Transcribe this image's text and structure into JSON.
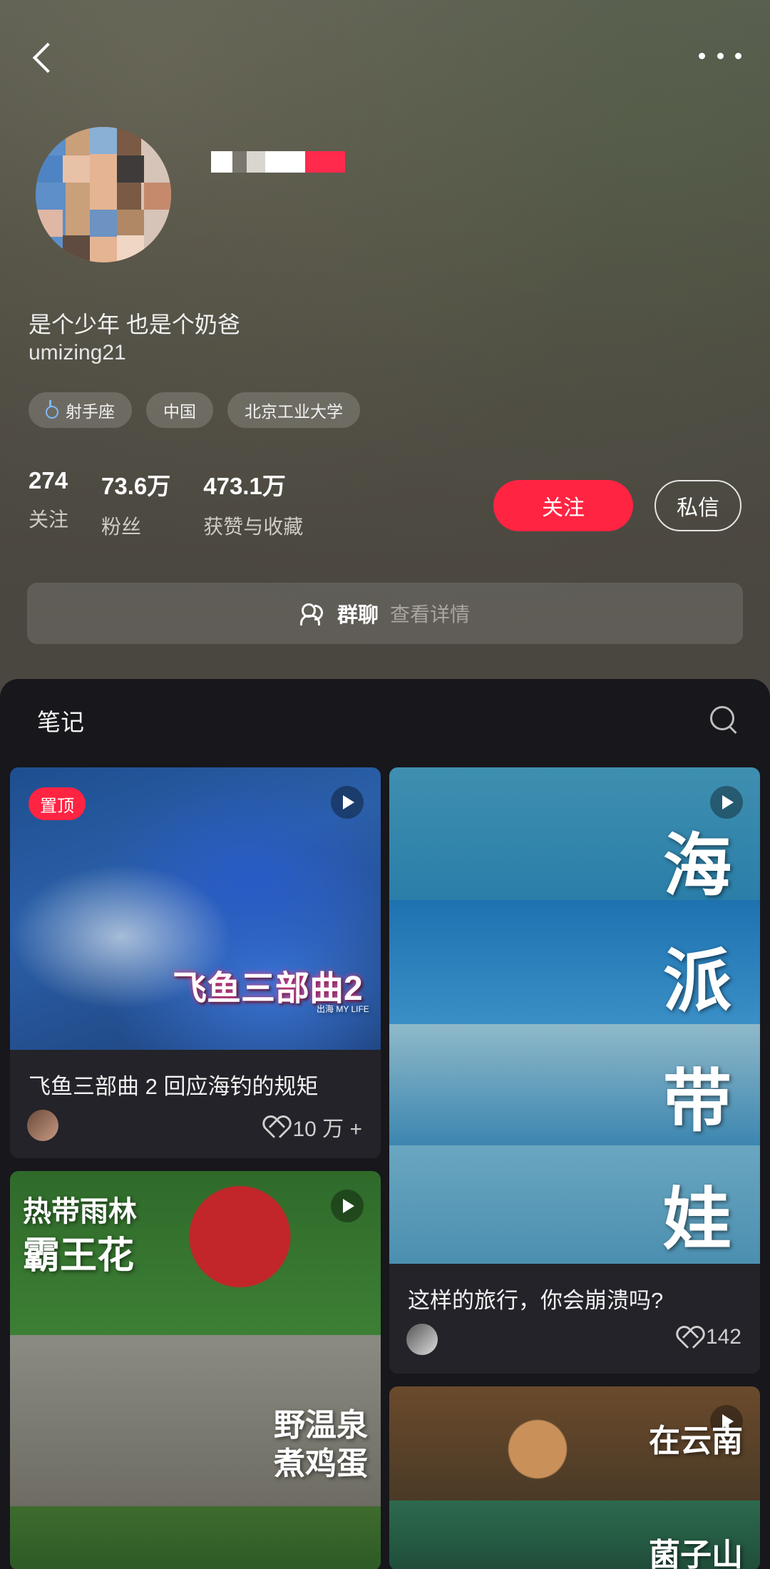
{
  "topbar": {
    "back_icon": "chevron-left-icon",
    "more_icon": "more-dots-icon"
  },
  "profile": {
    "bio": "是个少年 也是个奶爸",
    "user_id": "umizing21",
    "tags": [
      {
        "label": "射手座",
        "icon": "male-icon"
      },
      {
        "label": "中国"
      },
      {
        "label": "北京工业大学"
      }
    ],
    "stats": [
      {
        "value": "274",
        "label": "关注"
      },
      {
        "value": "73.6万",
        "label": "粉丝"
      },
      {
        "value": "473.1万",
        "label": "获赞与收藏"
      }
    ],
    "follow_label": "关注",
    "message_label": "私信"
  },
  "group_chat": {
    "title": "群聊",
    "detail": "查看详情"
  },
  "notes": {
    "tab_label": "笔记",
    "cards": [
      {
        "badge": "置顶",
        "cover_text": "飞鱼三部曲2",
        "cover_subtext": "出海 MY LIFE",
        "title": "飞鱼三部曲 2 回应海钓的规矩",
        "likes": "10 万 +"
      },
      {
        "cover_texts": [
          "海",
          "派",
          "带",
          "娃"
        ],
        "title": "这样的旅行，你会崩溃吗?",
        "likes": "142"
      },
      {
        "cover_texts": [
          "热带雨林",
          "霸王花",
          "野温泉",
          "煮鸡蛋"
        ]
      },
      {
        "cover_texts": [
          "在云南",
          "菌子山"
        ]
      }
    ]
  },
  "colors": {
    "accent": "#ff2442",
    "background": "#17171c",
    "card": "#232329"
  }
}
